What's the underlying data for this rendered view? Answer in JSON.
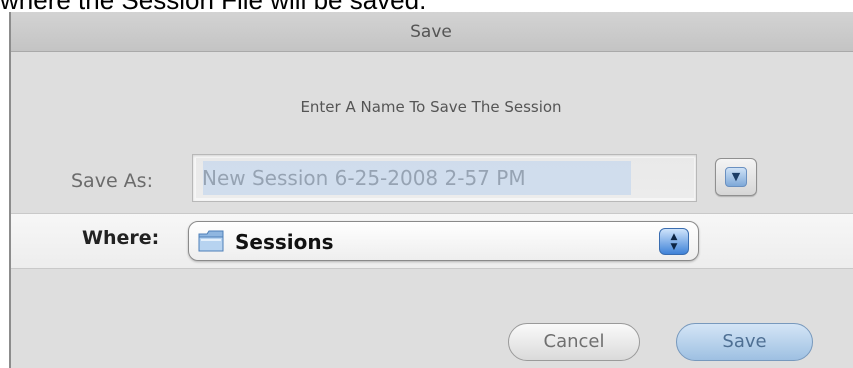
{
  "caption": {
    "text": "where the Session File will be saved."
  },
  "dialog": {
    "title": "Save",
    "prompt": "Enter A Name To Save The Session",
    "save_as": {
      "label": "Save As:",
      "value": "New Session 6-25-2008 2-57 PM"
    },
    "where": {
      "label": "Where:",
      "value": "Sessions"
    },
    "buttons": {
      "cancel": "Cancel",
      "save": "Save"
    }
  },
  "icons": {
    "expand": "disclosure-triangle-icon",
    "folder": "folder-icon",
    "popup": "up-down-arrows-icon"
  },
  "colors": {
    "default_button": "#9ec0e2",
    "selection": "#b9d1ee"
  }
}
